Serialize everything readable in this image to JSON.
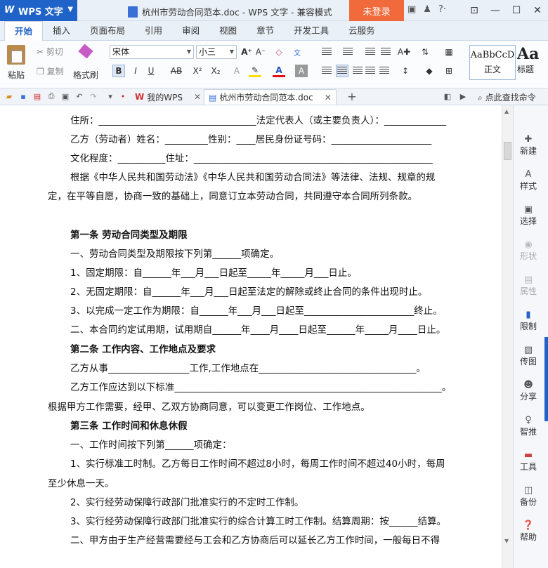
{
  "app": {
    "brand": "WPS 文字",
    "title": "杭州市劳动合同范本.doc - WPS 文字 - 兼容模式",
    "login": "未登录"
  },
  "tabs": [
    "开始",
    "插入",
    "页面布局",
    "引用",
    "审阅",
    "视图",
    "章节",
    "开发工具",
    "云服务"
  ],
  "ribbon": {
    "paste": "粘贴",
    "cut": "剪切",
    "copy": "复制",
    "format_painter": "格式刷",
    "font": "宋体",
    "size": "小三",
    "style_sample": "AaBbCcD",
    "style_name": "正文",
    "style2_sample": "Aa",
    "style2_name": "标题"
  },
  "quickbar": {
    "tab_mywps": "我的WPS",
    "tab_doc": "杭州市劳动合同范本.doc",
    "find": "点此查找命令"
  },
  "doc": {
    "l1": "住所：_________________________________法定代表人（或主要负责人）：_____________",
    "l2": "乙方（劳动者）姓名：_________性别：____居民身份证号码：_____________________",
    "l3": "文化程度：__________住址：__________________________________________________",
    "l4": "根据《中华人民共和国劳动法》《中华人民共和国劳动合同法》等法律、法规、规章的规",
    "l5": "定，在平等自愿，协商一致的基础上，同意订立本劳动合同，共同遵守本合同所列条款。",
    "h1": "第一条    劳动合同类型及期限",
    "l6": "一、劳动合同类型及期限按下列第______项确定。",
    "l7": "1、固定期限：自______年___月___日起至_____年_____月___日止。",
    "l8": "2、无固定期限：自______年___月___日起至法定的解除或终止合同的条件出现时止。",
    "l9": "3、以完成一定工作为期限：自______年___月___日起至_______________________终止。",
    "l10": "二、本合同约定试用期，试用期自______年____月____日起至______年_____月____日止。",
    "h2": "第二条    工作内容、工作地点及要求",
    "l11": "乙方从事_________________工作,工作地点在_________________________________。",
    "l12": "乙方工作应达到以下标准________________________________________________________。",
    "l13": "根据甲方工作需要，经甲、乙双方协商同意，可以变更工作岗位、工作地点。",
    "h3": "第三条    工作时间和休息休假",
    "l14": "一、工作时间按下列第______项确定：",
    "l15": "1、实行标准工时制。乙方每日工作时间不超过8小时，每周工作时间不超过40小时，每周",
    "l16": "至少休息一天。",
    "l17": "2、实行经劳动保障行政部门批准实行的不定时工作制。",
    "l18": "3、实行经劳动保障行政部门批准实行的综合计算工时工作制。结算周期：按______结算。",
    "l19": "二、甲方由于生产经营需要经与工会和乙方协商后可以延长乙方工作时间，一般每日不得"
  },
  "rpanel": [
    "新建",
    "样式",
    "选择",
    "形状",
    "属性",
    "限制",
    "传图",
    "分享",
    "智推",
    "工具",
    "备份",
    "帮助"
  ],
  "colors": {
    "brand": "#1f63c8",
    "login": "#f06a3c"
  }
}
